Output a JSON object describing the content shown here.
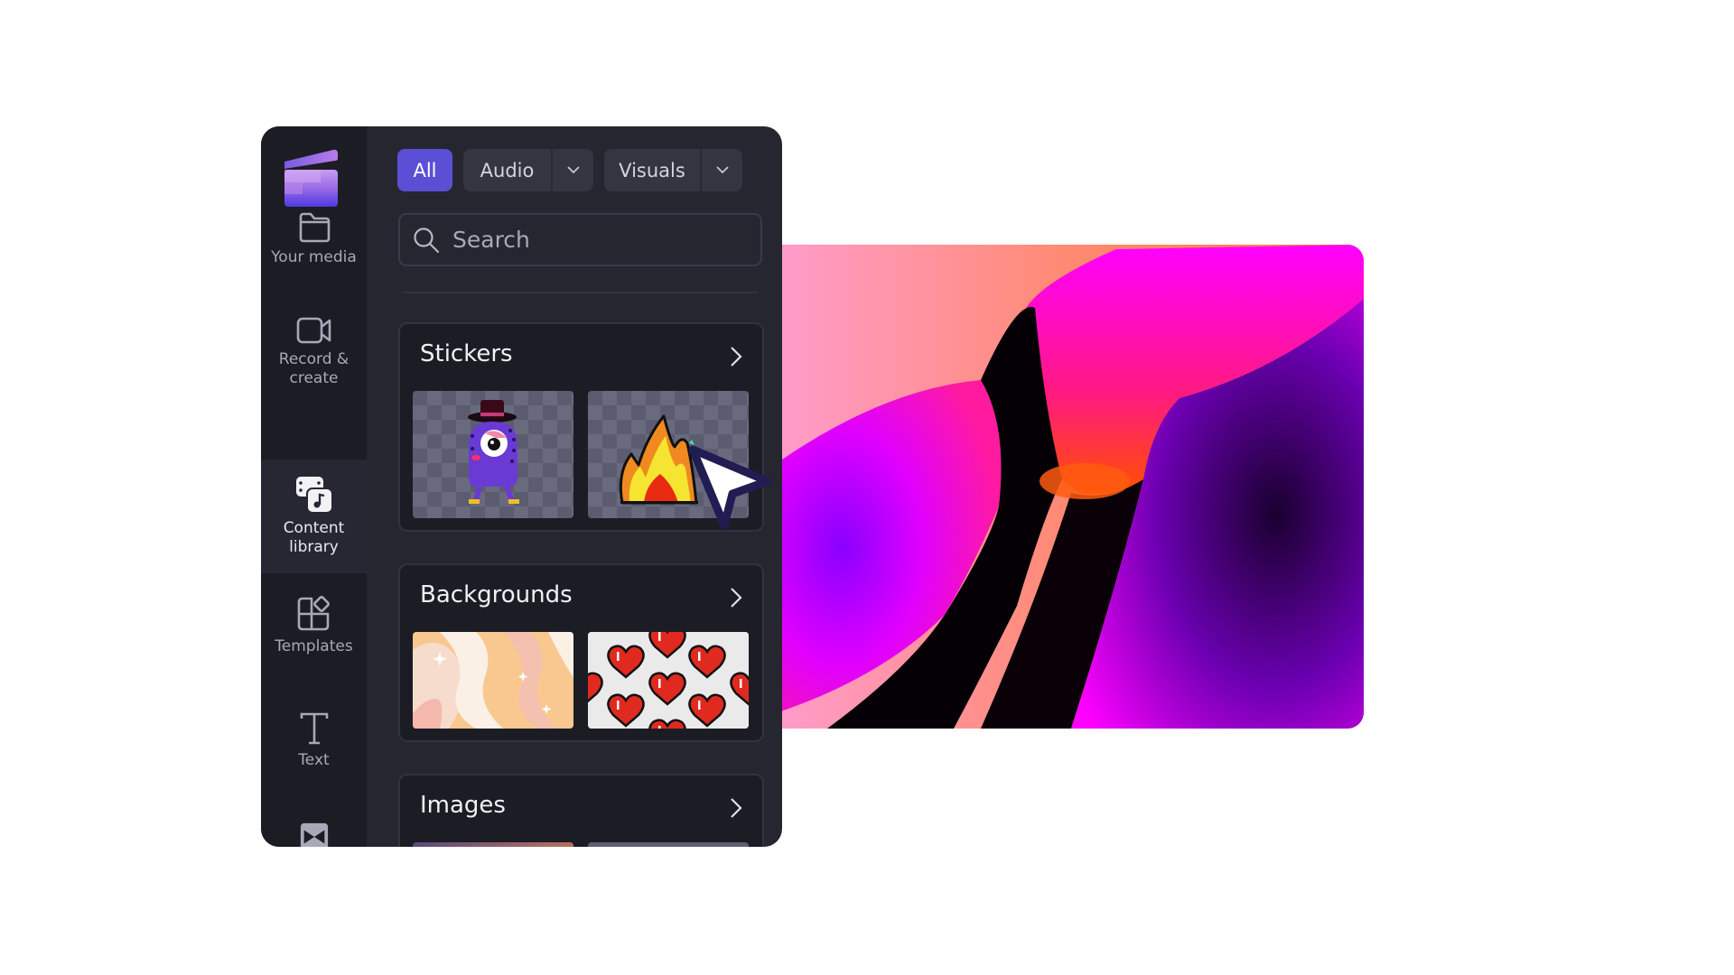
{
  "sidebar": {
    "logo": "clipchamp-logo",
    "items": [
      {
        "label": "Your media",
        "icon": "folder-icon",
        "active": false
      },
      {
        "label": "Record &\ncreate",
        "icon": "video-camera-icon",
        "active": false
      },
      {
        "label": "Content\nlibrary",
        "icon": "content-library-icon",
        "active": true
      },
      {
        "label": "Templates",
        "icon": "templates-icon",
        "active": false
      },
      {
        "label": "Text",
        "icon": "text-icon",
        "active": false
      },
      {
        "label": "",
        "icon": "transitions-icon",
        "active": false
      }
    ]
  },
  "filters": {
    "all": "All",
    "audio": "Audio",
    "visuals": "Visuals",
    "active": "All"
  },
  "search": {
    "placeholder": "Search",
    "value": ""
  },
  "sections": [
    {
      "title": "Stickers",
      "thumbs": [
        "purple-monster-sticker",
        "fire-sticker"
      ]
    },
    {
      "title": "Backgrounds",
      "thumbs": [
        "pastel-waves-background",
        "pixel-hearts-background"
      ]
    },
    {
      "title": "Images",
      "thumbs": [
        "image-1",
        "image-2"
      ]
    }
  ],
  "colors": {
    "accent": "#5b4fd6",
    "sidebar_bg": "#1c1c25",
    "panel_bg": "#262631"
  }
}
